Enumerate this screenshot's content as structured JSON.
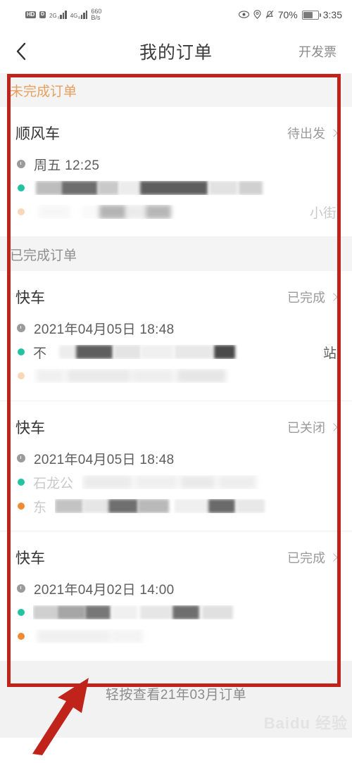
{
  "statusbar": {
    "hd_label": "HD",
    "volte_label": "D",
    "net1_label": "2G",
    "net2_label": "4G",
    "speed_value": "660",
    "speed_unit": "B/s",
    "eye_icon": "eye-icon",
    "location_icon": "location-pin-icon",
    "mute_icon": "bell-muted-icon",
    "battery_percent": "70%",
    "time": "3:35"
  },
  "navbar": {
    "back_icon": "chevron-left-icon",
    "title": "我的订单",
    "action_label": "开发票"
  },
  "sections": [
    {
      "id": "pending",
      "title": "未完成订单",
      "color": "#e5a05f",
      "orders": [
        {
          "type": "顺风车",
          "status": "待出发",
          "time": "周五 12:25",
          "origin_visible": "",
          "destination_visible": "小街"
        }
      ]
    },
    {
      "id": "completed",
      "title": "已完成订单",
      "color": "#8f8f8f",
      "orders": [
        {
          "type": "快车",
          "status": "已完成",
          "time": "2021年04月05日 18:48",
          "origin_visible": "不",
          "origin_tail": "站",
          "destination_visible": ""
        },
        {
          "type": "快车",
          "status": "已关闭",
          "time": "2021年04月05日 18:48",
          "origin_visible": "石龙公",
          "destination_visible": "东"
        },
        {
          "type": "快车",
          "status": "已完成",
          "time": "2021年04月02日 14:00",
          "origin_visible": "",
          "destination_visible": ""
        }
      ]
    }
  ],
  "footer": {
    "hint": "轻按查看21年03月订单",
    "watermark": "Baidu 经验"
  },
  "annotation": {
    "box_color": "#c0231a",
    "arrow_color": "#c0231a"
  }
}
